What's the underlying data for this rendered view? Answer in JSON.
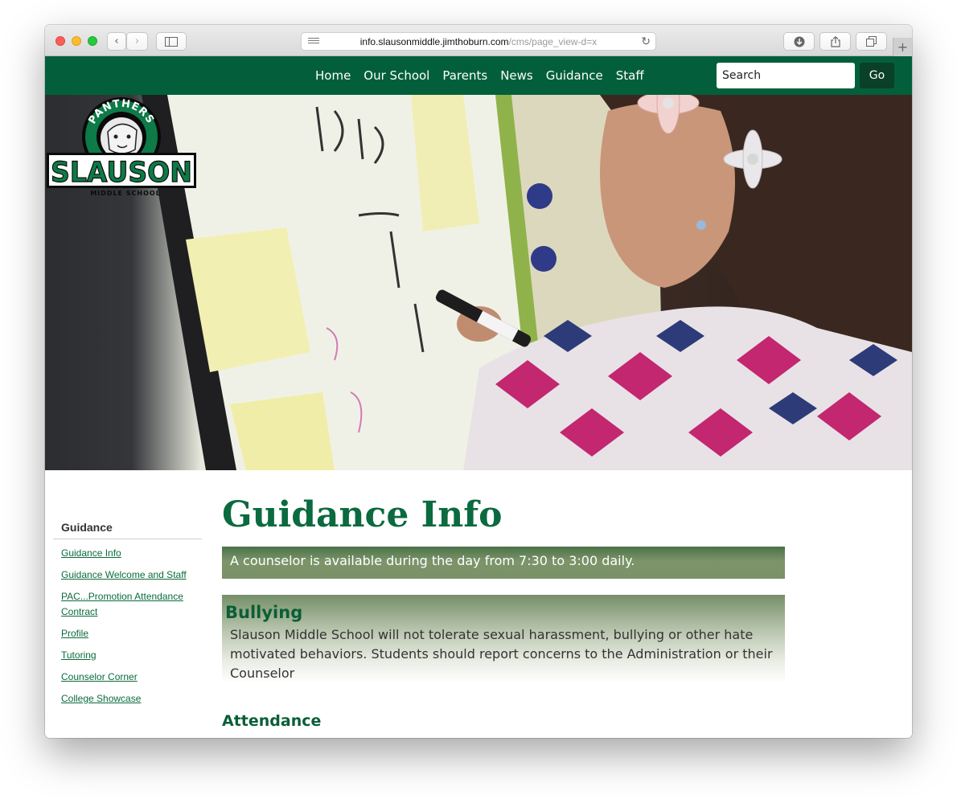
{
  "browser": {
    "url_domain": "info.slausonmiddle.jimthoburn.com",
    "url_path": "/cms/page_view-d=x"
  },
  "nav": {
    "items": [
      {
        "label": "Home"
      },
      {
        "label": "Our School"
      },
      {
        "label": "Parents"
      },
      {
        "label": "News"
      },
      {
        "label": "Guidance"
      },
      {
        "label": "Staff"
      }
    ],
    "search_placeholder": "Search",
    "go_label": "Go"
  },
  "logo": {
    "arc_text": "PANTHERS",
    "name": "SLAUSON",
    "subtitle": "MIDDLE SCHOOL"
  },
  "sidebar": {
    "title": "Guidance",
    "items": [
      {
        "label": "Guidance Info"
      },
      {
        "label": "Guidance Welcome and Staff"
      },
      {
        "label": "PAC...Promotion Attendance Contract"
      },
      {
        "label": "Profile"
      },
      {
        "label": "Tutoring"
      },
      {
        "label": "Counselor Corner"
      },
      {
        "label": "College Showcase"
      }
    ]
  },
  "main": {
    "title": "Guidance Info",
    "notice": "A counselor is available during the day from 7:30 to 3:00 daily.",
    "bullying_heading": "Bullying",
    "bullying_text": "Slauson Middle School will not tolerate sexual harassment, bullying or other hate motivated behaviors.  Students should report concerns to the Administration or their Counselor",
    "attendance_heading": "Attendance"
  },
  "colors": {
    "brand_green": "#035f3b",
    "title_green": "#0b6a3f"
  }
}
